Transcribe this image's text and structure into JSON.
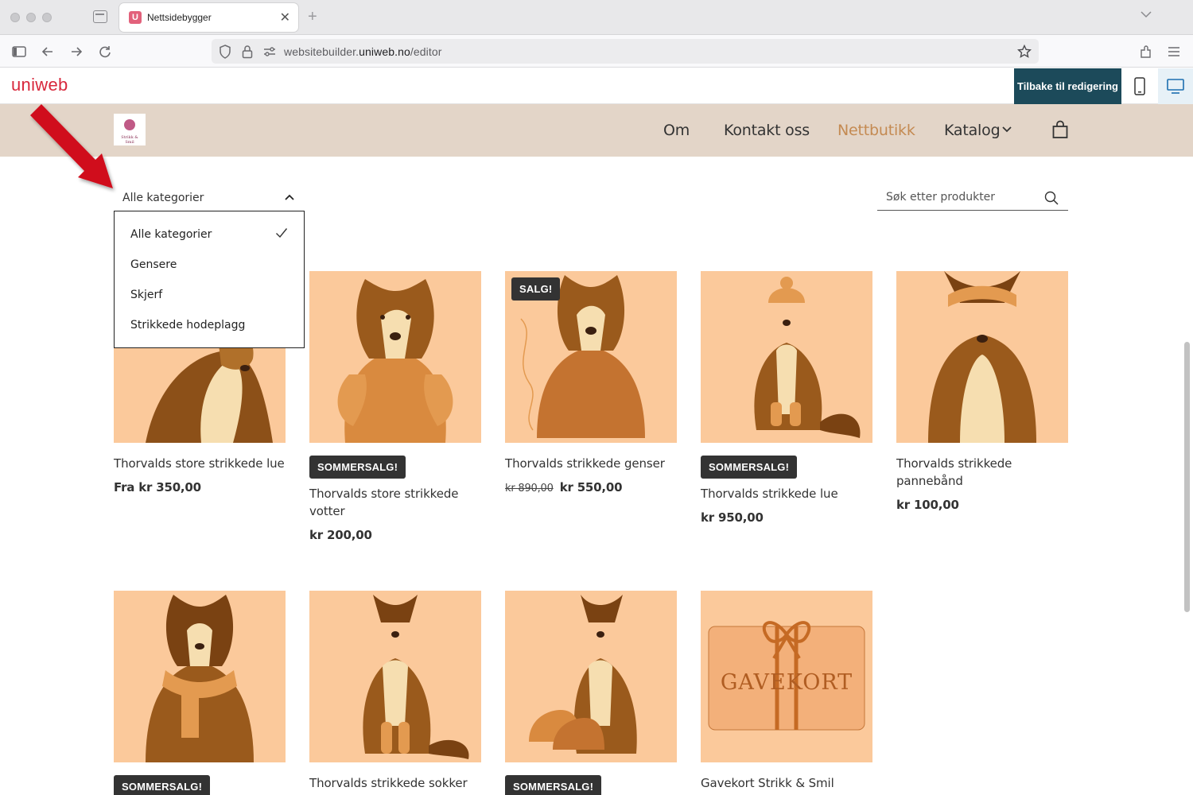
{
  "browser": {
    "tab_title": "Nettsidebygger",
    "favicon_letter": "U",
    "url_prefix": "websitebuilder.",
    "url_domain": "uniweb.no",
    "url_path": "/editor"
  },
  "editor": {
    "logo": "uniweb",
    "back_button": "Tilbake til redigering"
  },
  "site": {
    "logo_text": "Strikk & Smil",
    "menu": [
      {
        "label": "Om"
      },
      {
        "label": "Kontakt oss"
      },
      {
        "label": "Nettbutikk",
        "active": true
      },
      {
        "label": "Katalog"
      }
    ]
  },
  "shop": {
    "category_selected": "Alle kategorier",
    "category_options": [
      "Alle kategorier",
      "Gensere",
      "Skjerf",
      "Strikkede hodeplagg"
    ],
    "search_placeholder": "Søk etter produkter",
    "products": [
      {
        "name": "Thorvalds store strikkede lue",
        "price": "Fra kr 350,00",
        "badge": "",
        "old_price": ""
      },
      {
        "name": "Thorvalds store strikkede votter",
        "price": "kr 200,00",
        "badge": "SOMMERSALG!",
        "old_price": ""
      },
      {
        "name": "Thorvalds strikkede genser",
        "price": "kr 550,00",
        "badge": "SALG!",
        "old_price": "kr 890,00"
      },
      {
        "name": "Thorvalds strikkede lue",
        "price": "kr 950,00",
        "badge": "SOMMERSALG!",
        "old_price": ""
      },
      {
        "name": "Thorvalds strikkede pannebånd",
        "price": "kr 100,00",
        "badge": "",
        "old_price": ""
      },
      {
        "name": "",
        "price": "",
        "badge": "SOMMERSALG!",
        "old_price": ""
      },
      {
        "name": "Thorvalds strikkede sokker",
        "price": "",
        "badge": "",
        "old_price": ""
      },
      {
        "name": "",
        "price": "",
        "badge": "SOMMERSALG!",
        "old_price": ""
      },
      {
        "name": "Gavekort Strikk & Smil",
        "price": "",
        "badge": "",
        "old_price": ""
      }
    ],
    "giftcard_text": "GAVEKORT"
  },
  "colors": {
    "header_bg": "#e3d5c8",
    "accent": "#c48a52",
    "product_bg": "#fbc99b",
    "editor_dark": "#1c4a5a",
    "uniweb_red": "#d8283c",
    "arrow": "#d0101e"
  }
}
